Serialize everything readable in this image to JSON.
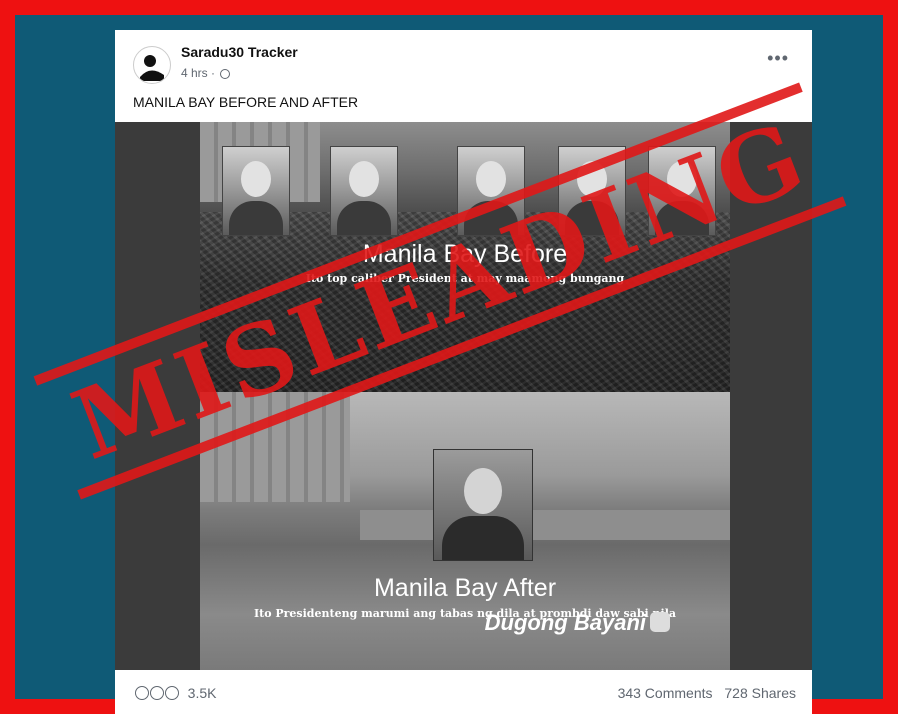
{
  "post": {
    "page_name": "Saradu30 Tracker",
    "time": "4 hrs ·",
    "caption": "MANILA BAY BEFORE AND AFTER",
    "more_icon": "more-options-icon"
  },
  "image": {
    "before_title": "Manila Bay Before",
    "before_subtitle": "Ito top caliber President at may maamong bungang",
    "after_title": "Manila Bay After",
    "after_subtitle": "Ito Presidenteng marumi ang tabas ng dila at prombdi daw sabi nila",
    "brand": "Dugong Bayani"
  },
  "stamp": {
    "text": "MISLEADING",
    "color": "#e01818"
  },
  "footer": {
    "reactions_count": "3.5K",
    "comments": "343 Comments",
    "shares": "728 Shares"
  },
  "colors": {
    "frame": "#ee1111",
    "background": "#0f5a76",
    "card": "#ffffff"
  }
}
